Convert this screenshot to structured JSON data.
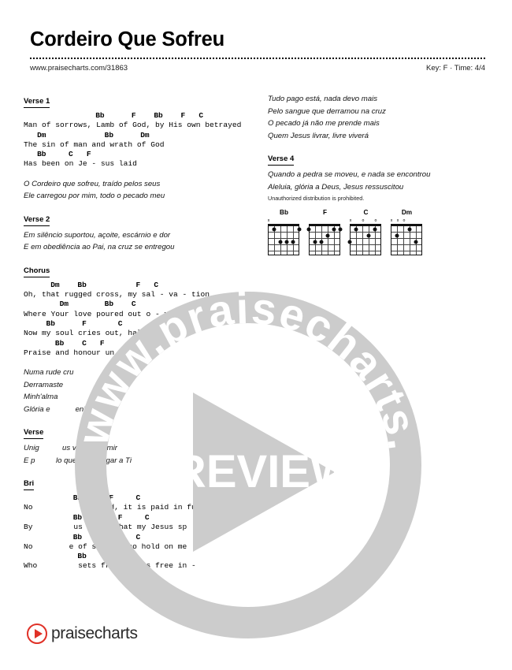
{
  "header": {
    "title": "Cordeiro Que Sofreu",
    "url": "www.praisecharts.com/31863",
    "key_time": "Key: F · Time: 4/4"
  },
  "left_column": {
    "sections": [
      {
        "label": "Verse 1",
        "lines": [
          {
            "type": "chord",
            "text": "                Bb      F    Bb    F   C"
          },
          {
            "type": "lyric",
            "text": "Man of sorrows, Lamb of God, by His own betrayed"
          },
          {
            "type": "chord",
            "text": "   Dm             Bb      Dm"
          },
          {
            "type": "lyric",
            "text": "The sin of man and wrath of God"
          },
          {
            "type": "chord",
            "text": "   Bb     C   F"
          },
          {
            "type": "lyric",
            "text": "Has been on Je - sus laid"
          }
        ]
      },
      {
        "label": "",
        "lines": [
          {
            "type": "plain",
            "text": "O Cordeiro que sofreu, traído pelos seus"
          },
          {
            "type": "plain",
            "text": "Ele carregou por mim, todo o pecado meu"
          }
        ]
      },
      {
        "label": "Verse 2",
        "lines": [
          {
            "type": "plain",
            "text": "Em silêncio suportou, açoite, escárnio e dor"
          },
          {
            "type": "plain",
            "text": "E em obediência ao Pai, na cruz se entregou"
          }
        ]
      },
      {
        "label": "Chorus",
        "lines": [
          {
            "type": "chord",
            "text": "      Dm    Bb           F   C"
          },
          {
            "type": "lyric",
            "text": "Oh, that rugged cross, my sal - va - tion"
          },
          {
            "type": "chord",
            "text": "        Dm        Bb    C"
          },
          {
            "type": "lyric",
            "text": "Where Your love poured out o - ver me"
          },
          {
            "type": "chord",
            "text": "     Bb      F       C"
          },
          {
            "type": "lyric",
            "text": "Now my soul cries out, halle"
          },
          {
            "type": "chord",
            "text": "       Bb    C   F"
          },
          {
            "type": "lyric",
            "text": "Praise and honour un"
          }
        ]
      },
      {
        "label": "",
        "lines": [
          {
            "type": "plain",
            "text": "Numa rude cru"
          },
          {
            "type": "plain",
            "text": "Derramaste"
          },
          {
            "type": "plain",
            "text": "Minh'alma                 bia"
          },
          {
            "type": "plain",
            "text": "Glória e            enhor"
          }
        ]
      },
      {
        "label": "Verse",
        "lines": [
          {
            "type": "plain",
            "text": "Unig           us vieste redimir"
          },
          {
            "type": "plain",
            "text": "E p          lo que se entregar a Ti"
          }
        ]
      },
      {
        "label": "Bri",
        "lines": [
          {
            "type": "chord",
            "text": "           Bb      F     C"
          },
          {
            "type": "lyric",
            "text": "No           is paid, it is paid in full"
          },
          {
            "type": "chord",
            "text": "           Bb        F     C"
          },
          {
            "type": "lyric",
            "text": "By         us blood that my Jesus sp"
          },
          {
            "type": "chord",
            "text": "           Bb      F     C"
          },
          {
            "type": "lyric",
            "text": "No        e of sin has no hold on me"
          },
          {
            "type": "chord",
            "text": "            Bb      F"
          },
          {
            "type": "lyric",
            "text": "Who         sets free, oh is free in -"
          }
        ]
      }
    ]
  },
  "right_column": {
    "sections": [
      {
        "label": "",
        "lines": [
          {
            "type": "plain",
            "text": "Tudo pago está, nada devo mais"
          },
          {
            "type": "plain",
            "text": "Pelo sangue que derramou na cruz"
          },
          {
            "type": "plain",
            "text": "O pecado já não me prende mais"
          },
          {
            "type": "plain",
            "text": "Quem Jesus livrar, livre viverá"
          }
        ]
      },
      {
        "label": "Verse 4",
        "lines": [
          {
            "type": "plain",
            "text": "Quando a pedra se moveu, e nada se encontrou"
          },
          {
            "type": "plain",
            "text": "Aleluia, glória a Deus, Jesus ressuscitou"
          }
        ]
      }
    ],
    "notice": "Unauthorized distribution is prohibited."
  },
  "chord_diagrams": [
    {
      "name": "Bb",
      "markers": [
        {
          "symbol": "x",
          "string": 1
        }
      ],
      "dots": [
        {
          "string": 2,
          "fret": 1
        },
        {
          "string": 6,
          "fret": 1
        },
        {
          "string": 3,
          "fret": 3
        },
        {
          "string": 4,
          "fret": 3
        },
        {
          "string": 5,
          "fret": 3
        }
      ]
    },
    {
      "name": "F",
      "markers": [],
      "dots": [
        {
          "string": 1,
          "fret": 1
        },
        {
          "string": 5,
          "fret": 1
        },
        {
          "string": 6,
          "fret": 1
        },
        {
          "string": 4,
          "fret": 2
        },
        {
          "string": 2,
          "fret": 3
        },
        {
          "string": 3,
          "fret": 3
        }
      ]
    },
    {
      "name": "C",
      "markers": [
        {
          "symbol": "x",
          "string": 1
        },
        {
          "symbol": "o",
          "string": 3
        },
        {
          "symbol": "o",
          "string": 5
        }
      ],
      "dots": [
        {
          "string": 5,
          "fret": 1
        },
        {
          "string": 2,
          "fret": 1
        },
        {
          "string": 4,
          "fret": 2
        },
        {
          "string": 1,
          "fret": 3
        }
      ]
    },
    {
      "name": "Dm",
      "markers": [
        {
          "symbol": "x",
          "string": 1
        },
        {
          "symbol": "x",
          "string": 2
        },
        {
          "symbol": "o",
          "string": 3
        }
      ],
      "dots": [
        {
          "string": 4,
          "fret": 1
        },
        {
          "string": 2,
          "fret": 2
        },
        {
          "string": 5,
          "fret": 3
        }
      ]
    }
  ],
  "watermark": {
    "ring_text": "www.praisecharts.com",
    "preview_text": "PREVIEW",
    "color": "#cccccc"
  },
  "footer": {
    "logo_text": "praisecharts",
    "logo_color": "#e03127",
    "play_icon": "play-triangle-icon"
  }
}
